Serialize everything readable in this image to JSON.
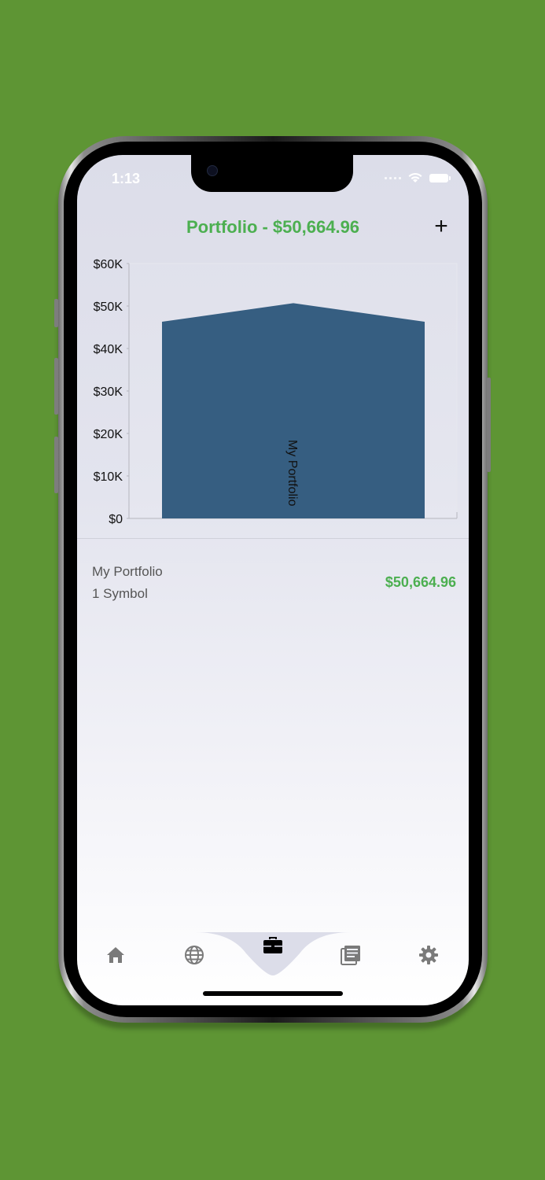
{
  "status_bar": {
    "time": "1:13"
  },
  "header": {
    "title": "Portfolio - $50,664.96",
    "add_label": "+"
  },
  "portfolio": {
    "name": "My Portfolio",
    "symbols": "1 Symbol",
    "value": "$50,664.96"
  },
  "colors": {
    "accent": "#4caf50",
    "area": "#365e81",
    "background": "#5e9534"
  },
  "tabs": [
    {
      "name": "home",
      "icon": "home-icon",
      "active": false
    },
    {
      "name": "globe",
      "icon": "globe-icon",
      "active": false
    },
    {
      "name": "portfolio",
      "icon": "briefcase-icon",
      "active": true
    },
    {
      "name": "news",
      "icon": "news-icon",
      "active": false
    },
    {
      "name": "settings",
      "icon": "gear-icon",
      "active": false
    }
  ],
  "chart_data": {
    "type": "area",
    "series": [
      {
        "name": "My Portfolio",
        "values": [
          46300,
          50664.96,
          46300
        ]
      }
    ],
    "x": [
      0,
      1,
      2
    ],
    "ylim": [
      0,
      60000
    ],
    "yticks": [
      "$60K",
      "$50K",
      "$40K",
      "$30K",
      "$20K",
      "$10K",
      "$0"
    ],
    "ytick_values": [
      60000,
      50000,
      40000,
      30000,
      20000,
      10000,
      0
    ],
    "grid": false
  }
}
